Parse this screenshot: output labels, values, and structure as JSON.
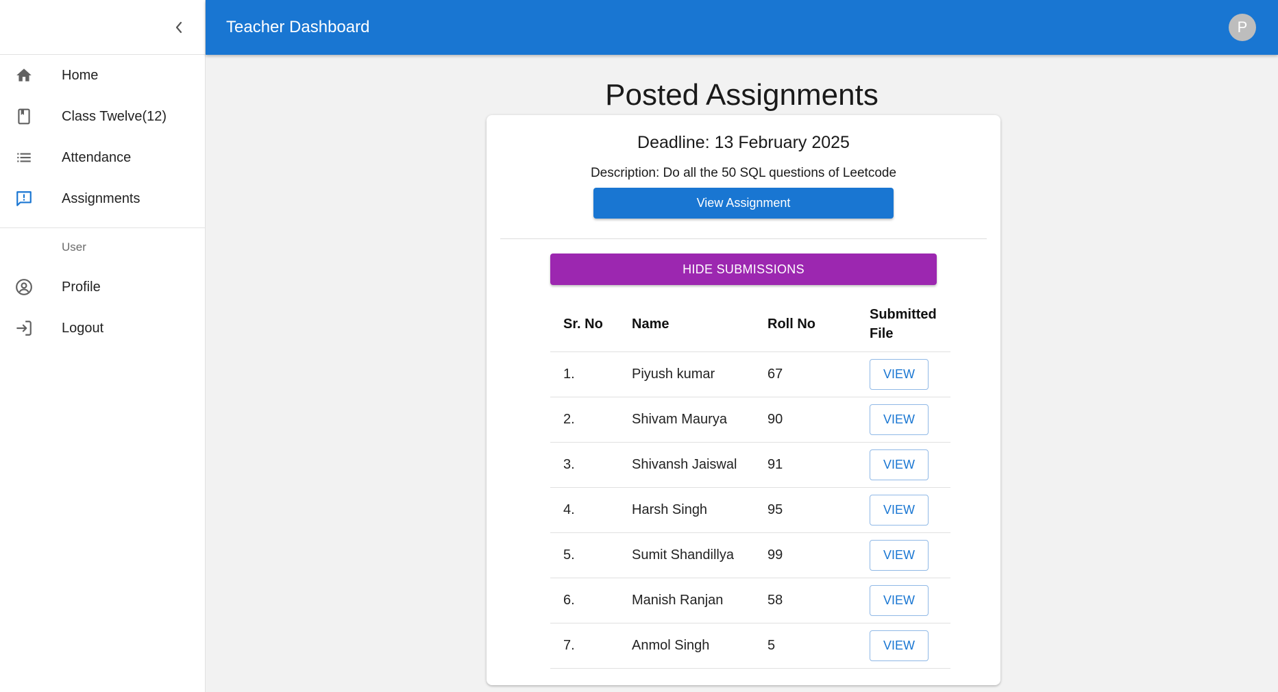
{
  "app": {
    "title": "Teacher Dashboard",
    "avatar_initial": "P"
  },
  "sidebar": {
    "items": [
      {
        "label": "Home",
        "icon": "home-icon"
      },
      {
        "label": "Class Twelve(12)",
        "icon": "class-book-icon"
      },
      {
        "label": "Attendance",
        "icon": "list-icon"
      },
      {
        "label": "Assignments",
        "icon": "feedback-icon",
        "active": true
      }
    ],
    "section_label": "User",
    "user_items": [
      {
        "label": "Profile",
        "icon": "account-circle-icon"
      },
      {
        "label": "Logout",
        "icon": "logout-icon"
      }
    ]
  },
  "main": {
    "page_title": "Posted Assignments",
    "assignment": {
      "deadline": "Deadline: 13 February 2025",
      "description": "Description: Do all the 50 SQL questions of Leetcode",
      "view_button": "View Assignment",
      "toggle_button": "HIDE SUBMISSIONS"
    },
    "table": {
      "headers": [
        "Sr. No",
        "Name",
        "Roll No",
        "Submitted File"
      ],
      "rows": [
        {
          "sr": "1.",
          "name": "Piyush kumar",
          "roll": "67",
          "action": "VIEW"
        },
        {
          "sr": "2.",
          "name": "Shivam Maurya",
          "roll": "90",
          "action": "VIEW"
        },
        {
          "sr": "3.",
          "name": "Shivansh Jaiswal",
          "roll": "91",
          "action": "VIEW"
        },
        {
          "sr": "4.",
          "name": "Harsh Singh",
          "roll": "95",
          "action": "VIEW"
        },
        {
          "sr": "5.",
          "name": "Sumit Shandillya",
          "roll": "99",
          "action": "VIEW"
        },
        {
          "sr": "6.",
          "name": "Manish Ranjan",
          "roll": "58",
          "action": "VIEW"
        },
        {
          "sr": "7.",
          "name": "Anmol Singh",
          "roll": "5",
          "action": "VIEW"
        }
      ]
    }
  },
  "colors": {
    "primary": "#1976d2",
    "secondary": "#9c27b0",
    "icon_gray": "#616161"
  }
}
